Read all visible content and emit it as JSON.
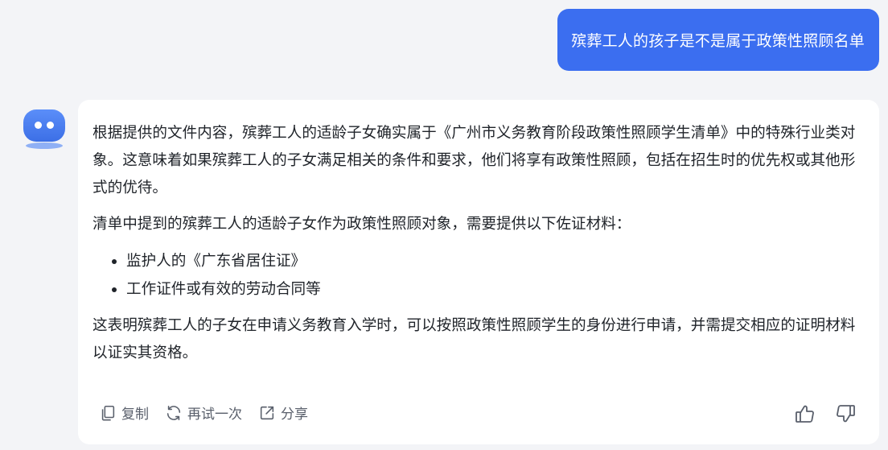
{
  "user_message": "殡葬工人的孩子是不是属于政策性照顾名单",
  "answer": {
    "paragraph1": "根据提供的文件内容，殡葬工人的适龄子女确实属于《广州市义务教育阶段政策性照顾学生清单》中的特殊行业类对象。这意味着如果殡葬工人的子女满足相关的条件和要求，他们将享有政策性照顾，包括在招生时的优先权或其他形式的优待。",
    "paragraph2": "清单中提到的殡葬工人的适龄子女作为政策性照顾对象，需要提供以下佐证材料：",
    "list": [
      "监护人的《广东省居住证》",
      "工作证件或有效的劳动合同等"
    ],
    "paragraph3": "这表明殡葬工人的子女在申请义务教育入学时，可以按照政策性照顾学生的身份进行申请，并需提交相应的证明材料以证实其资格。"
  },
  "actions": {
    "copy_label": "复制",
    "retry_label": "再试一次",
    "share_label": "分享"
  },
  "icons": {
    "copy": "copy-icon",
    "retry": "refresh-icon",
    "share": "share-icon",
    "like": "thumbs-up-icon",
    "dislike": "thumbs-down-icon"
  },
  "colors": {
    "user_bubble": "#3b6ef0",
    "background": "#f3f4f7",
    "card": "#ffffff",
    "action_text": "#595f6b"
  }
}
